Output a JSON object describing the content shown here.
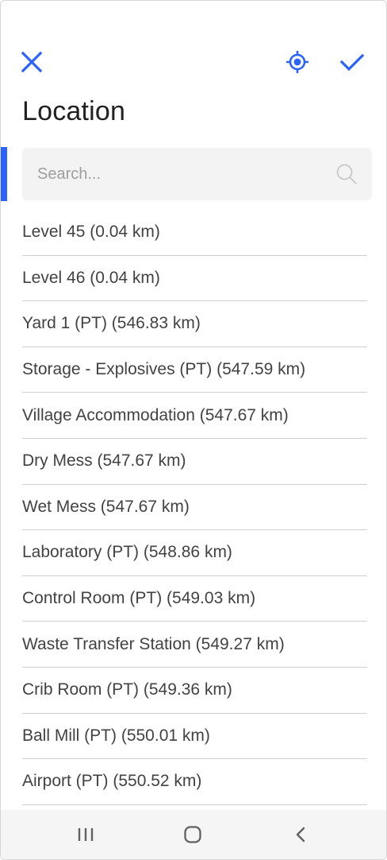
{
  "header": {
    "title": "Location",
    "close_icon": "close-icon",
    "locate_icon": "my-location-icon",
    "confirm_icon": "check-icon",
    "accent_color": "#2962ff"
  },
  "search": {
    "placeholder": "Search...",
    "value": "",
    "icon": "search-icon"
  },
  "locations": [
    {
      "label": "Level 45 (0.04 km)"
    },
    {
      "label": "Level 46 (0.04 km)"
    },
    {
      "label": "Yard 1 (PT) (546.83 km)"
    },
    {
      "label": "Storage - Explosives (PT) (547.59 km)"
    },
    {
      "label": "Village Accommodation (547.67 km)"
    },
    {
      "label": "Dry Mess (547.67 km)"
    },
    {
      "label": "Wet Mess (547.67 km)"
    },
    {
      "label": "Laboratory (PT) (548.86 km)"
    },
    {
      "label": "Control Room (PT) (549.03 km)"
    },
    {
      "label": "Waste Transfer Station (549.27 km)"
    },
    {
      "label": "Crib Room (PT) (549.36 km)"
    },
    {
      "label": "Ball Mill (PT) (550.01 km)"
    },
    {
      "label": "Airport (PT) (550.52 km)"
    }
  ],
  "navbar": {
    "recents_icon": "recents-icon",
    "home_icon": "home-icon",
    "back_icon": "back-icon"
  }
}
